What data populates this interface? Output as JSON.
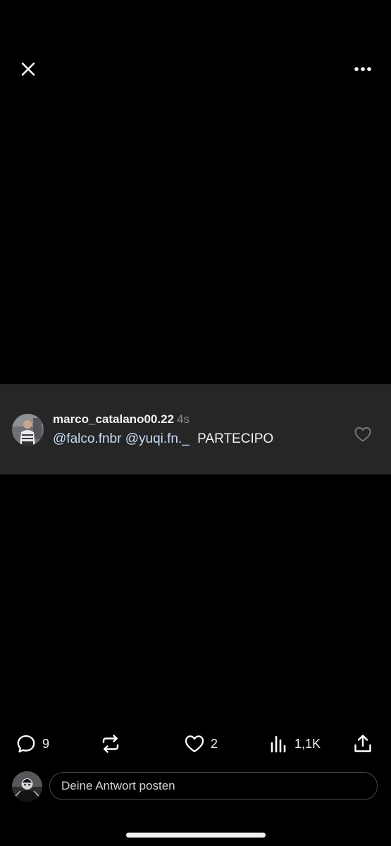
{
  "top_bar": {
    "close_icon": "close-icon",
    "more_icon": "more-horizontal-icon"
  },
  "comment": {
    "username": "marco_catalano00.22",
    "time": "4s",
    "mentions": [
      "@falco.fnbr",
      "@yuqi.fn._"
    ],
    "body": "PARTECIPO",
    "like_icon": "heart-outline-icon"
  },
  "actions": {
    "reply": {
      "icon": "comment-icon",
      "count": "9"
    },
    "repost": {
      "icon": "repost-icon",
      "count": ""
    },
    "like": {
      "icon": "heart-outline-icon",
      "count": "2"
    },
    "views": {
      "icon": "bar-chart-icon",
      "count": "1,1K"
    },
    "share": {
      "icon": "share-icon",
      "count": ""
    }
  },
  "reply_box": {
    "placeholder": "Deine Antwort posten"
  },
  "colors": {
    "background": "#000000",
    "comment_card": "#262626",
    "mention": "#c8dcf7",
    "muted": "#8a8a8a"
  }
}
